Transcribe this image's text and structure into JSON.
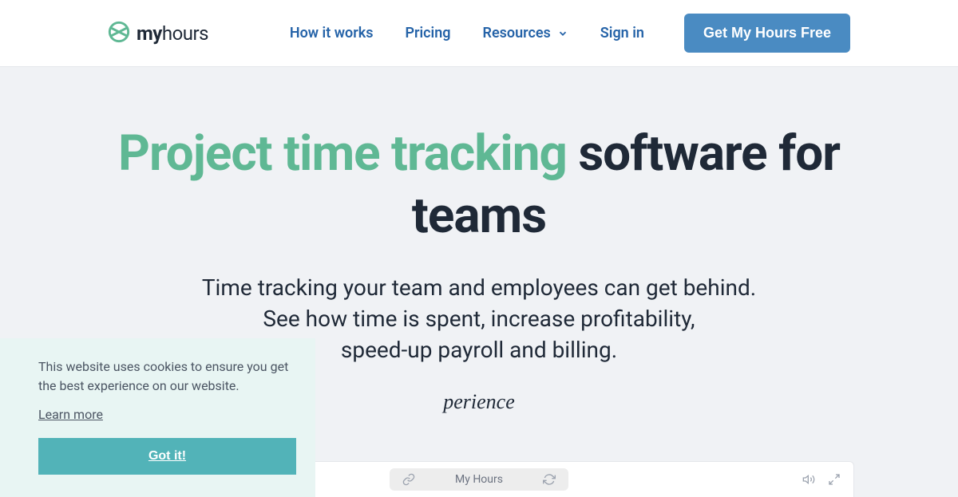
{
  "header": {
    "logo": {
      "text_bold": "my",
      "text_regular": "hours"
    },
    "nav": {
      "how_it_works": "How it works",
      "pricing": "Pricing",
      "resources": "Resources",
      "sign_in": "Sign in"
    },
    "cta": "Get My Hours Free"
  },
  "hero": {
    "title_accent": "Project time tracking",
    "title_rest": " software for teams",
    "subtitle_line1": "Time tracking your team and employees can get behind.",
    "subtitle_line2": "See how time is spent, increase profitability,",
    "subtitle_line3": "speed-up payroll and billing.",
    "cursive_partial": "perience"
  },
  "cookie": {
    "text": "This website uses cookies to ensure you get the best experience on our website.",
    "learn_more": "Learn more",
    "button": "Got it!"
  },
  "video_bar": {
    "title": "My Hours"
  }
}
